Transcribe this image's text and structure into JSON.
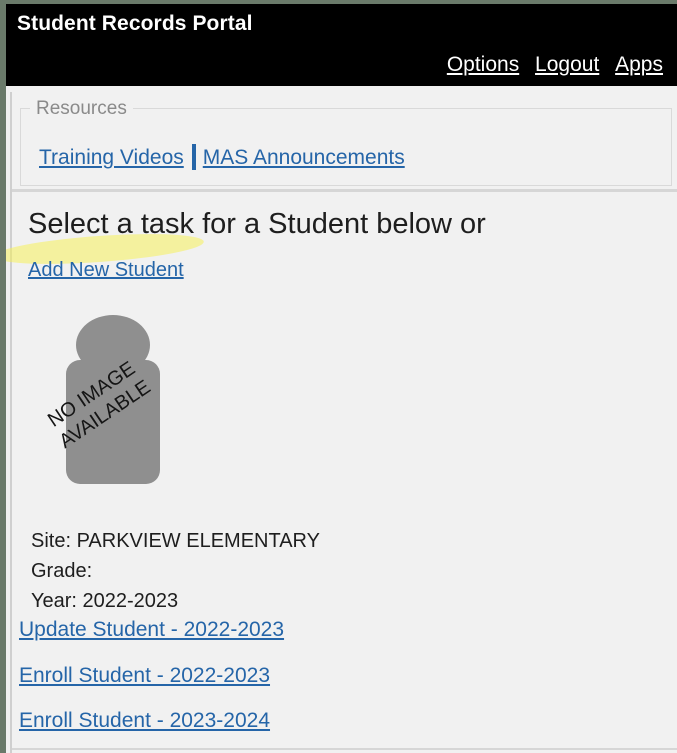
{
  "header": {
    "title": "Student Records Portal",
    "links": [
      "Options",
      "Logout",
      "Apps"
    ]
  },
  "resources": {
    "legend": "Resources",
    "links": [
      "Training Videos",
      "MAS Announcements"
    ]
  },
  "task": {
    "heading": "Select a task for a Student below or",
    "add_link": "Add New Student"
  },
  "photo": {
    "caption_line1": "NO IMAGE",
    "caption_line2": "AVAILABLE"
  },
  "student": {
    "site": "Site: PARKVIEW ELEMENTARY",
    "grade": "Grade:",
    "year": "Year: 2022-2023"
  },
  "actions": [
    "Update Student - 2022-2023",
    "Enroll Student - 2022-2023",
    "Enroll Student - 2023-2024"
  ],
  "colors": {
    "header_bg": "#000000",
    "link": "#2565a8",
    "highlight": "#f5f05a",
    "page_bg": "#f1f1f1"
  }
}
